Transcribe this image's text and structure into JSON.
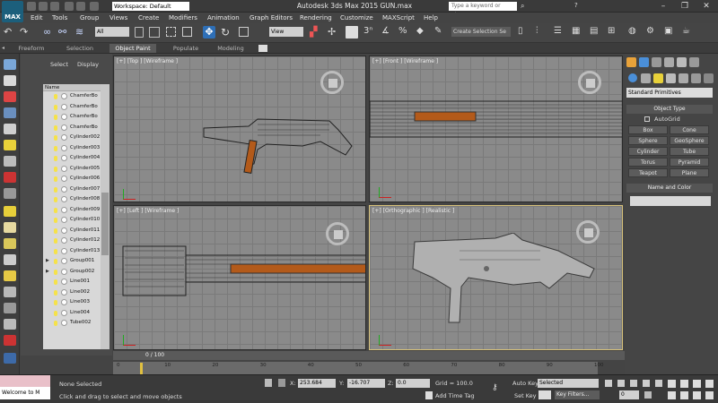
{
  "window": {
    "title": "Autodesk 3ds Max  2015     GUN.max",
    "logo_text": "MAX",
    "workspace": "Workspace: Default",
    "search_placeholder": "Type a keyword or phrase",
    "help_icon": "?"
  },
  "menu": [
    "Edit",
    "Tools",
    "Group",
    "Views",
    "Create",
    "Modifiers",
    "Animation",
    "Graph Editors",
    "Rendering",
    "Customize",
    "MAXScript",
    "Help"
  ],
  "toolbar": {
    "filter": "All",
    "view": "View",
    "selection_set": "Create Selection Se"
  },
  "ribbon_tabs": [
    "Freeform",
    "Selection",
    "Object Paint",
    "Populate",
    "Modeling"
  ],
  "ribbon_active": "Object Paint",
  "scene_explorer": {
    "tabs": [
      "Select",
      "Display"
    ],
    "column_header": "Name",
    "items": [
      {
        "name": "ChamferBo",
        "group": false
      },
      {
        "name": "ChamferBo",
        "group": false
      },
      {
        "name": "ChamferBo",
        "group": false
      },
      {
        "name": "ChamferBo",
        "group": false
      },
      {
        "name": "Cylinder002",
        "group": false
      },
      {
        "name": "Cylinder003",
        "group": false
      },
      {
        "name": "Cylinder004",
        "group": false
      },
      {
        "name": "Cylinder005",
        "group": false
      },
      {
        "name": "Cylinder006",
        "group": false
      },
      {
        "name": "Cylinder007",
        "group": false
      },
      {
        "name": "Cylinder008",
        "group": false
      },
      {
        "name": "Cylinder009",
        "group": false
      },
      {
        "name": "Cylinder010",
        "group": false
      },
      {
        "name": "Cylinder011",
        "group": false
      },
      {
        "name": "Cylinder012",
        "group": false
      },
      {
        "name": "Cylinder013",
        "group": false
      },
      {
        "name": "Group001",
        "group": true
      },
      {
        "name": "Group002",
        "group": true
      },
      {
        "name": "Line001",
        "group": false
      },
      {
        "name": "Line002",
        "group": false
      },
      {
        "name": "Line003",
        "group": false
      },
      {
        "name": "Line004",
        "group": false
      },
      {
        "name": "Tube002",
        "group": false
      }
    ]
  },
  "viewports": {
    "top": "[+] [Top ] [Wireframe ]",
    "front": "[+] [Front ] [Wireframe ]",
    "left": "[+] [Left ] [Wireframe ]",
    "persp": "[+] [Orthographic ] [Realistic ]"
  },
  "command_panel": {
    "category": "Standard Primitives",
    "object_type_title": "Object Type",
    "autogrid": "AutoGrid",
    "buttons": [
      "Box",
      "Cone",
      "Sphere",
      "GeoSphere",
      "Cylinder",
      "Tube",
      "Torus",
      "Pyramid",
      "Teapot",
      "Plane"
    ],
    "name_color_title": "Name and Color"
  },
  "timeline": {
    "frame": "0 / 100",
    "ticks": [
      "0",
      "10",
      "20",
      "30",
      "40",
      "50",
      "60",
      "70",
      "80",
      "90",
      "100"
    ]
  },
  "status": {
    "welcome": "Welcome to M",
    "selection": "None Selected",
    "prompt": "Click and drag to select and move objects",
    "x_label": "X:",
    "x": "253.684",
    "y_label": "Y:",
    "y": "-16.707",
    "z_label": "Z:",
    "z": "0.0",
    "grid": "Grid = 100.0",
    "add_time_tag": "Add Time Tag",
    "auto_key": "Auto Key",
    "auto_key_mode": "Selected",
    "set_key": "Set Key",
    "key_filters": "Key Filters...",
    "frame_field": "0"
  },
  "colors": {
    "accent_wood": "#b35a1a",
    "viewport_bg": "#8a8a8a",
    "active_border": "#d8c27a"
  }
}
